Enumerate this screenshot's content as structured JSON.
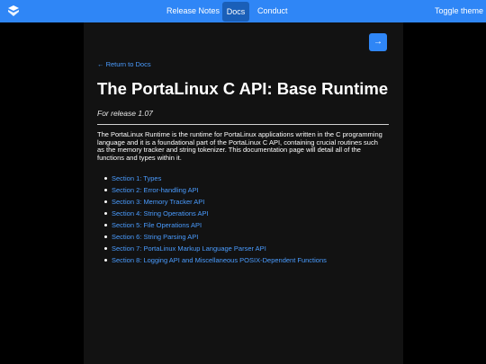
{
  "header": {
    "nav": [
      "Release Notes",
      "Docs",
      "Conduct"
    ],
    "active_nav": "Docs",
    "toggle_label": "Toggle theme",
    "accent_color": "#2f86f6"
  },
  "page": {
    "next_button_label": "→",
    "back_link": "← Return to Docs",
    "title": "The PortaLinux C API: Base Runtime",
    "release": "For release 1.07",
    "intro": "The PortaLinux Runtime is the runtime for PortaLinux applications written in the C programming language and it is a foundational part of the PortaLinux C API, containing crucial routines such as the memory tracker and string tokenizer. This documentation page will detail all of the functions and types within it.",
    "sections": [
      "Section 1: Types",
      "Section 2: Error-handling API",
      "Section 3: Memory Tracker API",
      "Section 4: String Operations API",
      "Section 5: File Operations API",
      "Section 6: String Parsing API",
      "Section 7: PortaLinux Markup Language Parser API",
      "Section 8: Logging API and Miscellaneous POSIX-Dependent Functions"
    ]
  }
}
